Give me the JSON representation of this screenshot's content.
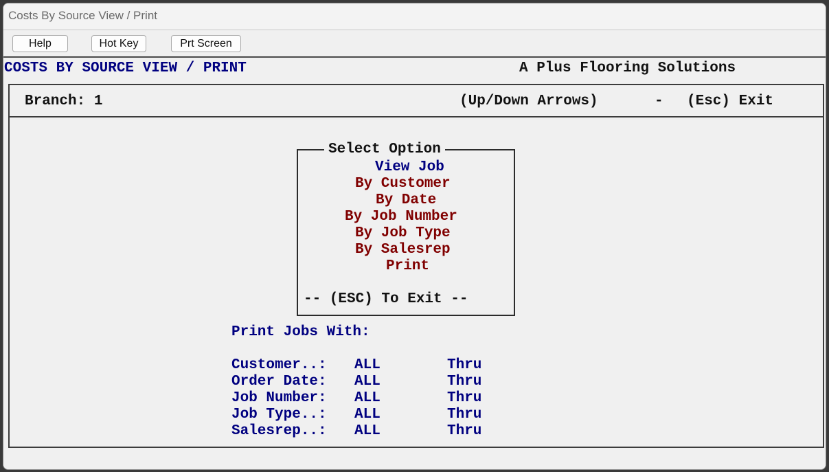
{
  "window": {
    "title": "Costs By Source View / Print"
  },
  "toolbar": {
    "help_label": "Help",
    "hotkey_label": "Hot Key",
    "prtscreen_label": "Prt Screen"
  },
  "header": {
    "screen_title": "COSTS BY SOURCE VIEW / PRINT",
    "company": "A Plus Flooring Solutions"
  },
  "status": {
    "branch": "Branch: 1",
    "nav_hint": "(Up/Down Arrows)",
    "dash": "-",
    "esc_hint": "(Esc) Exit"
  },
  "menu": {
    "title": "Select Option",
    "items": [
      "View Job",
      "By Customer",
      "By Date",
      "By Job Number",
      "By Job Type",
      "By Salesrep",
      "Print"
    ],
    "selected_index": 0,
    "exit_text": "-- (ESC) To Exit --"
  },
  "print_section": {
    "heading": "Print Jobs With:",
    "thru_label": "Thru",
    "filters": [
      {
        "label": "Customer..:",
        "value": "ALL"
      },
      {
        "label": "Order Date:",
        "value": "ALL"
      },
      {
        "label": "Job Number:",
        "value": "ALL"
      },
      {
        "label": "Job Type..:",
        "value": "ALL"
      },
      {
        "label": "Salesrep..:",
        "value": "ALL"
      }
    ]
  },
  "colors": {
    "highlight": "#000080",
    "option": "#800000",
    "text": "#111111",
    "background": "#f0f0f0"
  }
}
